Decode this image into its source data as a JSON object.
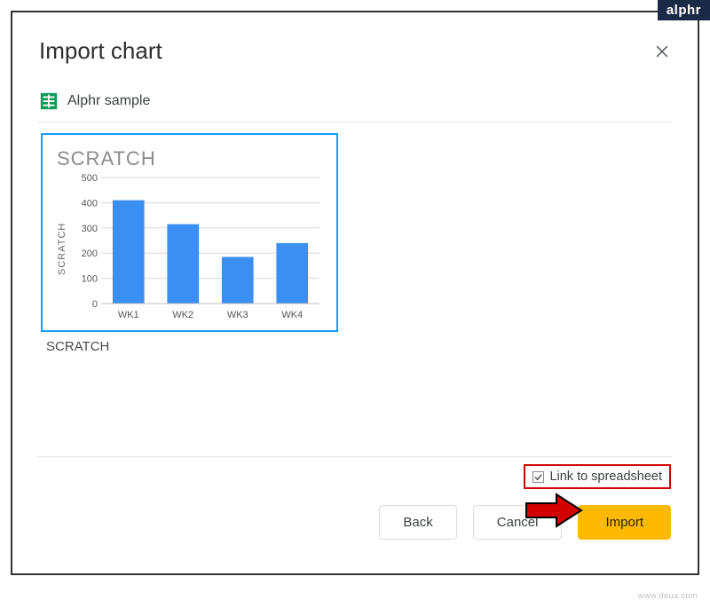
{
  "brand": "alphr",
  "dialog": {
    "title": "Import chart",
    "file_name": "Alphr sample"
  },
  "chart_card": {
    "title": "SCRATCH",
    "caption": "SCRATCH"
  },
  "chart_data": {
    "type": "bar",
    "title": "SCRATCH",
    "ylabel": "SCRATCH",
    "xlabel": "",
    "categories": [
      "WK1",
      "WK2",
      "WK3",
      "WK4"
    ],
    "values": [
      410,
      315,
      185,
      240
    ],
    "ylim": [
      0,
      500
    ],
    "yticks": [
      0,
      100,
      200,
      300,
      400,
      500
    ],
    "grid": true
  },
  "link_checkbox": {
    "checked": true,
    "label": "Link to spreadsheet"
  },
  "buttons": {
    "back": "Back",
    "cancel": "Cancel",
    "import": "Import"
  },
  "watermark": "www.deua.com"
}
